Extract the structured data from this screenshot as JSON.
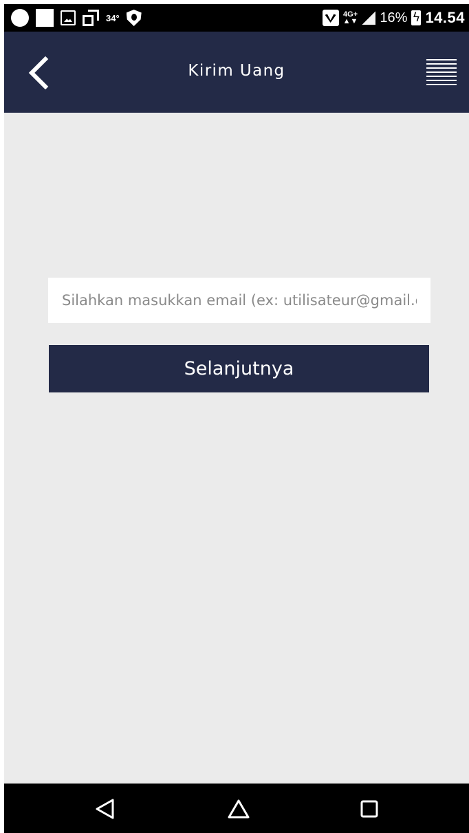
{
  "status_bar": {
    "temperature": "34°",
    "network": "4G+",
    "battery_percent": "16%",
    "time": "14.54",
    "icons": [
      "circle-notification-icon",
      "square-notification-icon",
      "image-icon",
      "copy-icon",
      "shield-icon",
      "wifi-icon",
      "signal-icon",
      "battery-charging-icon"
    ]
  },
  "header": {
    "title": "Kirim Uang",
    "back_icon": "chevron-left-icon",
    "menu_icon": "hamburger-menu-icon"
  },
  "form": {
    "email_placeholder": "Silahkan masukkan email (ex: utilisateur@gmail.com)",
    "email_value": "",
    "next_label": "Selanjutnya"
  },
  "nav_bar": {
    "icons": [
      "nav-back-icon",
      "nav-home-icon",
      "nav-recent-icon"
    ]
  },
  "colors": {
    "primary": "#232a47",
    "background": "#ebebeb",
    "input_bg": "#ffffff"
  }
}
